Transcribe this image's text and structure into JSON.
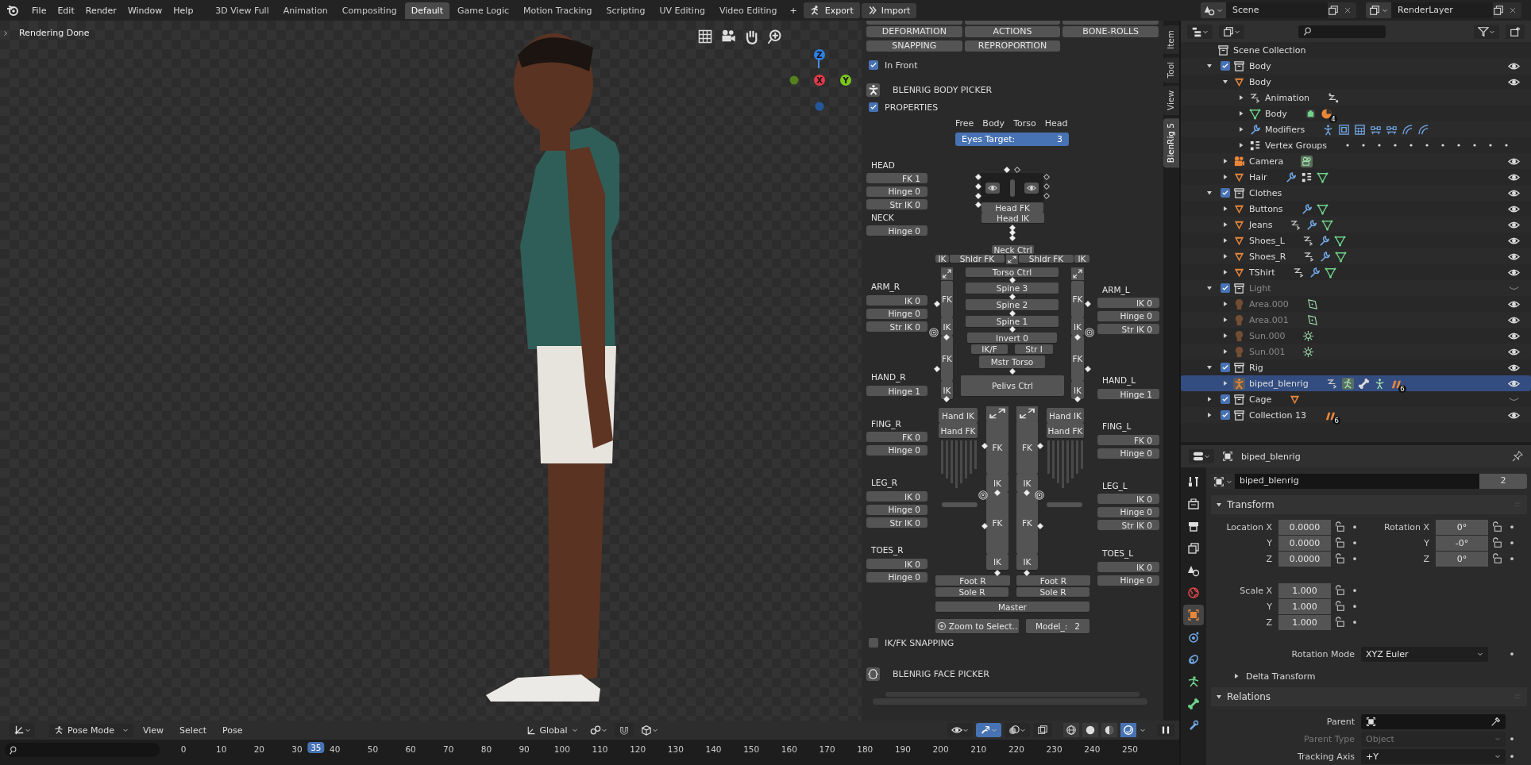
{
  "topbar": {
    "menus": [
      "File",
      "Edit",
      "Render",
      "Window",
      "Help"
    ],
    "workspaces": [
      {
        "label": "3D View Full",
        "selected": false
      },
      {
        "label": "Animation",
        "selected": false
      },
      {
        "label": "Compositing",
        "selected": false
      },
      {
        "label": "Default",
        "selected": true
      },
      {
        "label": "Game Logic",
        "selected": false
      },
      {
        "label": "Motion Tracking",
        "selected": false
      },
      {
        "label": "Scripting",
        "selected": false
      },
      {
        "label": "UV Editing",
        "selected": false
      },
      {
        "label": "Video Editing",
        "selected": false
      }
    ],
    "add_tab": "+",
    "export": "Export",
    "import": "Import",
    "scene": "Scene",
    "view_layer": "RenderLayer"
  },
  "viewport": {
    "status": "Rendering Done",
    "axes": [
      "Z",
      "X",
      "Y"
    ]
  },
  "sidebar_tabs": [
    {
      "label": "Item",
      "selected": false
    },
    {
      "label": "Tool",
      "selected": false
    },
    {
      "label": "View",
      "selected": false
    },
    {
      "label": "BlenRig 5",
      "selected": true
    }
  ],
  "picker": {
    "top_buttons": [
      "DEFORMATION",
      "ACTIONS",
      "BONE-ROLLS",
      "SNAPPING",
      "REPROPORTION"
    ],
    "in_front": {
      "label": "In Front",
      "checked": true
    },
    "body_picker": "BLENRIG BODY PICKER",
    "properties": {
      "label": "PROPERTIES",
      "checked": true
    },
    "eyes_modes": [
      "Free",
      "Body",
      "Torso",
      "Head"
    ],
    "eyes_target": {
      "label": "Eyes Target:",
      "value": "3"
    },
    "left_groups": [
      {
        "title": "HEAD",
        "buttons": [
          "FK 1",
          "Hinge 0",
          "Str IK 0"
        ]
      },
      {
        "title": "NECK",
        "buttons": [
          "Hinge 0"
        ]
      },
      {
        "title": "ARM_R",
        "buttons": [
          "IK 0",
          "Hinge 0",
          "Str IK 0"
        ]
      },
      {
        "title": "HAND_R",
        "buttons": [
          "Hinge 1"
        ]
      },
      {
        "title": "FING_R",
        "buttons": [
          "FK 0",
          "Hinge 0"
        ]
      },
      {
        "title": "LEG_R",
        "buttons": [
          "IK 0",
          "Hinge 0",
          "Str IK 0"
        ]
      },
      {
        "title": "TOES_R",
        "buttons": [
          "IK 0",
          "Hinge 0"
        ]
      }
    ],
    "right_groups": [
      {
        "title": "ARM_L",
        "buttons": [
          "IK 0",
          "Hinge 0",
          "Str IK 0"
        ]
      },
      {
        "title": "HAND_L",
        "buttons": [
          "Hinge 1"
        ]
      },
      {
        "title": "FING_L",
        "buttons": [
          "FK 0",
          "Hinge 0"
        ]
      },
      {
        "title": "LEG_L",
        "buttons": [
          "IK 0",
          "Hinge 0",
          "Str IK 0"
        ]
      },
      {
        "title": "TOES_L",
        "buttons": [
          "IK 0",
          "Hinge 0"
        ]
      }
    ],
    "bones": [
      "Head FK",
      "Head IK",
      "Neck Ctrl",
      "IK",
      "Shldr FK",
      "Shldr FK",
      "IK",
      "Torso Ctrl",
      "Spine 3",
      "Spine 2",
      "Spine 1",
      "Invert 0",
      "IK/F",
      "Str I",
      "Mstr Torso",
      "Pelivs Ctrl",
      "FK",
      "IK",
      "FK",
      "IK",
      "FK",
      "IK",
      "FK",
      "IK",
      "Hand IK",
      "Hand FK",
      "Hand IK",
      "Hand FK",
      "FK",
      "IK",
      "FK",
      "IK",
      "FK",
      "IK",
      "FK",
      "IK",
      "Foot R",
      "Foot R",
      "Sole R",
      "Sole R",
      "Master"
    ],
    "zoom_button": "Zoom to Select..",
    "model": {
      "label": "Model_:",
      "value": "2"
    },
    "snapping": {
      "label": "IK/FK SNAPPING",
      "checked": false
    },
    "face_picker": "BLENRIG FACE PICKER"
  },
  "viewport_header": {
    "mode": "Pose Mode",
    "menus": [
      "View",
      "Select",
      "Pose"
    ],
    "orientation": "Global",
    "toggles": [
      {
        "kind": "visibility",
        "on": false
      },
      {
        "kind": "gizmo",
        "on": true
      },
      {
        "kind": "overlay",
        "on": false
      },
      {
        "kind": "xray",
        "on": false
      }
    ],
    "shading": [
      {
        "kind": "wireframe",
        "selected": false
      },
      {
        "kind": "solid",
        "selected": false
      },
      {
        "kind": "material",
        "selected": false
      },
      {
        "kind": "rendered",
        "selected": true
      }
    ]
  },
  "timeline": {
    "ticks": [
      "0",
      "10",
      "20",
      "30",
      "40",
      "50",
      "60",
      "70",
      "80",
      "90",
      "100",
      "110",
      "120",
      "130",
      "140",
      "150",
      "160",
      "170",
      "180",
      "190",
      "200",
      "210",
      "220",
      "230",
      "240",
      "250"
    ],
    "playhead": {
      "label": "35",
      "level": 0.14
    }
  },
  "outliner": {
    "root": "Scene Collection",
    "items": [
      {
        "name": "Body",
        "kind": "collection",
        "expanded": true,
        "checked": true,
        "visible": true,
        "dimmed": false,
        "selected": false,
        "children": [
          {
            "name": "Body",
            "kind": "mesh",
            "expanded": true,
            "visible": true,
            "selected": false,
            "children": [
              {
                "name": "Animation",
                "kind": "animation",
                "expanded": false,
                "selected": false,
                "tags": [
                  {
                    "kind": "action"
                  }
                ]
              },
              {
                "name": "Body",
                "kind": "mesh-data",
                "expanded": false,
                "selected": false,
                "tags": [
                  {
                    "kind": "shape-keys"
                  },
                  {
                    "kind": "material",
                    "count": "4"
                  }
                ]
              },
              {
                "name": "Modifiers",
                "kind": "modifiers",
                "expanded": false,
                "selected": false,
                "tags": [
                  {
                    "kind": "armature-mod"
                  },
                  {
                    "kind": "mod-box"
                  },
                  {
                    "kind": "mod-grid"
                  },
                  {
                    "kind": "mod-link"
                  },
                  {
                    "kind": "mod-link"
                  },
                  {
                    "kind": "mod-curve"
                  },
                  {
                    "kind": "mod-curve"
                  }
                ]
              },
              {
                "name": "Vertex Groups",
                "kind": "vertex-groups",
                "expanded": false,
                "selected": false,
                "tags": [
                  {
                    "kind": "dots"
                  }
                ]
              }
            ]
          },
          {
            "name": "Camera",
            "kind": "camera",
            "expanded": false,
            "visible": true,
            "selected": false,
            "tags": [
              {
                "kind": "camera-data"
              }
            ]
          },
          {
            "name": "Hair",
            "kind": "mesh",
            "expanded": false,
            "visible": true,
            "selected": false,
            "tags": [
              {
                "kind": "wrench"
              },
              {
                "kind": "vgroup"
              },
              {
                "kind": "mesh-data"
              }
            ]
          }
        ]
      },
      {
        "name": "Clothes",
        "kind": "collection",
        "expanded": true,
        "checked": true,
        "visible": true,
        "dimmed": false,
        "selected": false,
        "children": [
          {
            "name": "Buttons",
            "kind": "mesh",
            "expanded": false,
            "visible": true,
            "selected": false,
            "tags": [
              {
                "kind": "wrench"
              },
              {
                "kind": "mesh-data"
              }
            ]
          },
          {
            "name": "Jeans",
            "kind": "mesh",
            "expanded": false,
            "visible": true,
            "selected": false,
            "tags": [
              {
                "kind": "anim"
              },
              {
                "kind": "wrench"
              },
              {
                "kind": "mesh-data"
              }
            ]
          },
          {
            "name": "Shoes_L",
            "kind": "mesh",
            "expanded": false,
            "visible": true,
            "selected": false,
            "tags": [
              {
                "kind": "anim"
              },
              {
                "kind": "wrench"
              },
              {
                "kind": "mesh-data"
              }
            ]
          },
          {
            "name": "Shoes_R",
            "kind": "mesh",
            "expanded": false,
            "visible": true,
            "selected": false,
            "tags": [
              {
                "kind": "anim"
              },
              {
                "kind": "wrench"
              },
              {
                "kind": "mesh-data"
              }
            ]
          },
          {
            "name": "TShirt",
            "kind": "mesh",
            "expanded": false,
            "visible": true,
            "selected": false,
            "tags": [
              {
                "kind": "anim"
              },
              {
                "kind": "wrench"
              },
              {
                "kind": "mesh-data"
              }
            ]
          }
        ]
      },
      {
        "name": "Light",
        "kind": "collection",
        "expanded": true,
        "checked": true,
        "visible": false,
        "dimmed": true,
        "selected": false,
        "children": [
          {
            "name": "Area.000",
            "kind": "light",
            "expanded": false,
            "visible": true,
            "selected": false,
            "tags": [
              {
                "kind": "area-light"
              }
            ]
          },
          {
            "name": "Area.001",
            "kind": "light",
            "expanded": false,
            "visible": true,
            "selected": false,
            "tags": [
              {
                "kind": "area-light"
              }
            ]
          },
          {
            "name": "Sun.000",
            "kind": "light",
            "expanded": false,
            "visible": true,
            "selected": false,
            "tags": [
              {
                "kind": "sun"
              }
            ]
          },
          {
            "name": "Sun.001",
            "kind": "light",
            "expanded": false,
            "visible": true,
            "selected": false,
            "tags": [
              {
                "kind": "sun"
              }
            ]
          }
        ]
      },
      {
        "name": "Rig",
        "kind": "collection",
        "expanded": true,
        "checked": true,
        "visible": true,
        "dimmed": false,
        "selected": false,
        "children": [
          {
            "name": "biped_blenrig",
            "kind": "armature",
            "expanded": false,
            "visible": true,
            "selected": true,
            "tags": [
              {
                "kind": "anim"
              },
              {
                "kind": "pose"
              },
              {
                "kind": "bone"
              },
              {
                "kind": "armature-data"
              },
              {
                "kind": "bones",
                "count": "6"
              }
            ]
          }
        ]
      },
      {
        "name": "Cage",
        "kind": "collection",
        "expanded": false,
        "checked": true,
        "visible": false,
        "dimmed": false,
        "selected": false,
        "tags": [
          {
            "kind": "mesh-object"
          }
        ]
      },
      {
        "name": "Collection 13",
        "kind": "collection",
        "expanded": false,
        "checked": true,
        "visible": true,
        "dimmed": false,
        "selected": false,
        "tags": [
          {
            "kind": "bones",
            "count": "6"
          }
        ]
      }
    ]
  },
  "properties": {
    "tabs": [
      {
        "kind": "tool",
        "selected": false
      },
      {
        "kind": "render",
        "selected": false
      },
      {
        "kind": "output",
        "selected": false
      },
      {
        "kind": "view-layer",
        "selected": false
      },
      {
        "kind": "scene",
        "selected": false
      },
      {
        "kind": "world",
        "selected": false
      },
      {
        "kind": "object",
        "selected": true
      },
      {
        "kind": "physics",
        "selected": false
      },
      {
        "kind": "constraints",
        "selected": false
      },
      {
        "kind": "armature",
        "selected": false
      },
      {
        "kind": "bone",
        "selected": false
      },
      {
        "kind": "bone-constraint",
        "selected": false
      }
    ],
    "header": "biped_blenrig",
    "datablock": {
      "name": "biped_blenrig",
      "users": "2"
    },
    "transform": {
      "title": "Transform",
      "expanded": true,
      "location": [
        {
          "label": "Location X",
          "value": "0.0000"
        },
        {
          "label": "Y",
          "value": "0.0000"
        },
        {
          "label": "Z",
          "value": "0.0000"
        }
      ],
      "rotation": [
        {
          "label": "Rotation X",
          "value": "0°"
        },
        {
          "label": "Y",
          "value": "-0°"
        },
        {
          "label": "Z",
          "value": "0°"
        }
      ],
      "scale": [
        {
          "label": "Scale X",
          "value": "1.000"
        },
        {
          "label": "Y",
          "value": "1.000"
        },
        {
          "label": "Z",
          "value": "1.000"
        }
      ],
      "rotation_mode": {
        "label": "Rotation Mode",
        "value": "XYZ Euler"
      }
    },
    "delta": {
      "title": "Delta Transform",
      "expanded": false
    },
    "relations": {
      "title": "Relations",
      "expanded": true,
      "fields": [
        {
          "label": "Parent",
          "kind": "object",
          "disabled": false
        },
        {
          "label": "Parent Type",
          "value": "Object",
          "kind": "dropdown",
          "disabled": true
        },
        {
          "label": "Tracking Axis",
          "value": "+Y",
          "kind": "dropdown",
          "disabled": false
        }
      ]
    }
  }
}
